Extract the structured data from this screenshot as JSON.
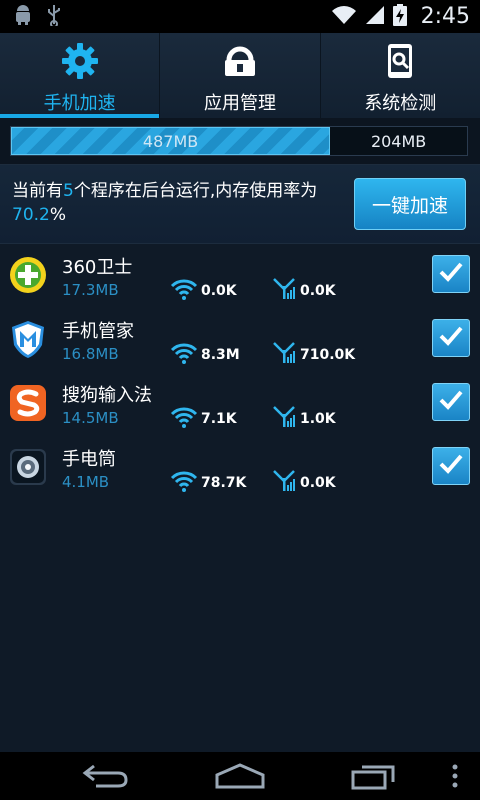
{
  "status_bar": {
    "time": "2:45",
    "icons": [
      "android-icon",
      "usb-icon",
      "wifi-icon",
      "signal-icon",
      "battery-charging-icon"
    ]
  },
  "tabs": [
    {
      "label": "手机加速",
      "icon": "gear-icon",
      "active": true
    },
    {
      "label": "应用管理",
      "icon": "lock-icon",
      "active": false
    },
    {
      "label": "系统检测",
      "icon": "phone-search-icon",
      "active": false
    }
  ],
  "memory": {
    "used_label": "487MB",
    "free_label": "204MB",
    "used_fraction": 0.7
  },
  "summary": {
    "text_1": "当前有",
    "count": "5",
    "text_2": "个程序在后台运行,内存使用率为",
    "percent": "70.2",
    "text_3": "%",
    "boost_button": "一键加速"
  },
  "apps": [
    {
      "name": "360卫士",
      "size": "17.3MB",
      "wifi": "0.0K",
      "mobile": "0.0K",
      "checked": true,
      "icon": "360-security-icon"
    },
    {
      "name": "手机管家",
      "size": "16.8MB",
      "wifi": "8.3M",
      "mobile": "710.0K",
      "checked": true,
      "icon": "phone-manager-icon"
    },
    {
      "name": "搜狗输入法",
      "size": "14.5MB",
      "wifi": "7.1K",
      "mobile": "1.0K",
      "checked": true,
      "icon": "sogou-input-icon"
    },
    {
      "name": "手电筒",
      "size": "4.1MB",
      "wifi": "78.7K",
      "mobile": "0.0K",
      "checked": true,
      "icon": "flashlight-icon"
    }
  ],
  "colors": {
    "accent": "#1fb4f0",
    "background": "#0f1a27"
  }
}
